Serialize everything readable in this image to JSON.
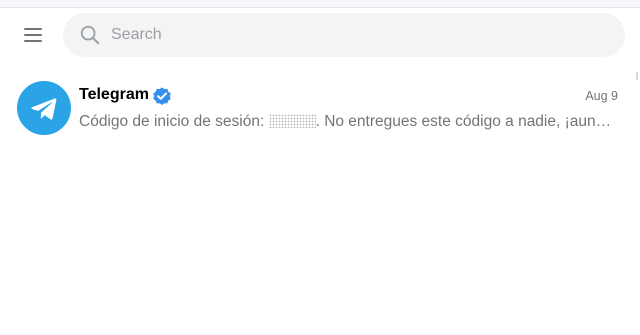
{
  "header": {
    "menu_icon": "hamburger-menu-icon",
    "search": {
      "placeholder": "Search",
      "value": "",
      "icon": "search-icon"
    }
  },
  "chats": [
    {
      "title": "Telegram",
      "verified": true,
      "date": "Aug 9",
      "preview_before": "Código de inicio de sesión: ",
      "preview_after": ". No entregues este código a nadie, ¡aun…",
      "avatar_icon": "telegram-plane-icon",
      "avatar_color": "#2aa3e7"
    }
  ],
  "colors": {
    "accent": "#3390ec",
    "search_bg": "#f4f4f5",
    "secondary_text": "#707579"
  }
}
